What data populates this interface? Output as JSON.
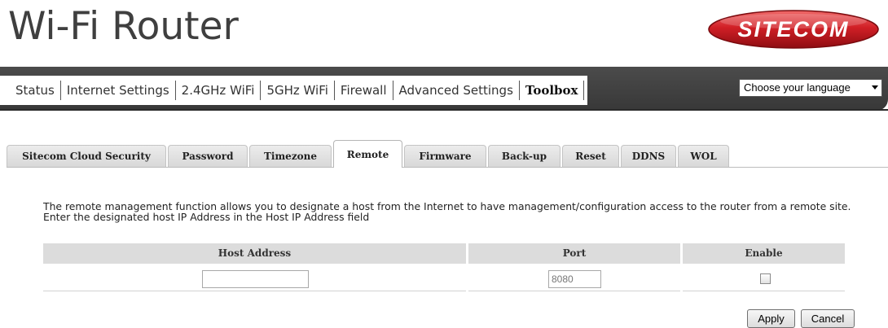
{
  "header": {
    "title": "Wi-Fi Router",
    "logo_text": "SITECOM"
  },
  "nav": {
    "items": [
      {
        "label": "Status"
      },
      {
        "label": "Internet Settings"
      },
      {
        "label": "2.4GHz WiFi"
      },
      {
        "label": "5GHz WiFi"
      },
      {
        "label": "Firewall"
      },
      {
        "label": "Advanced Settings"
      },
      {
        "label": "Toolbox",
        "active": true
      }
    ],
    "language_select": "Choose your language"
  },
  "tabs": [
    {
      "label": "Sitecom Cloud Security"
    },
    {
      "label": "Password"
    },
    {
      "label": "Timezone"
    },
    {
      "label": "Remote",
      "active": true
    },
    {
      "label": "Firmware"
    },
    {
      "label": "Back-up"
    },
    {
      "label": "Reset"
    },
    {
      "label": "DDNS"
    },
    {
      "label": "WOL"
    }
  ],
  "remote": {
    "description": "The remote management function allows you to designate a host from the Internet to have management/configuration access to the router from a remote site. Enter the designated host IP Address in the Host IP Address field",
    "columns": {
      "host": "Host Address",
      "port": "Port",
      "enable": "Enable"
    },
    "host_value": "",
    "port_value": "8080",
    "enabled": false
  },
  "buttons": {
    "apply": "Apply",
    "cancel": "Cancel"
  },
  "colors": {
    "navbar": "#3f3f3f",
    "logo_red": "#c8202a",
    "header_bg": "#dcdcdc"
  }
}
